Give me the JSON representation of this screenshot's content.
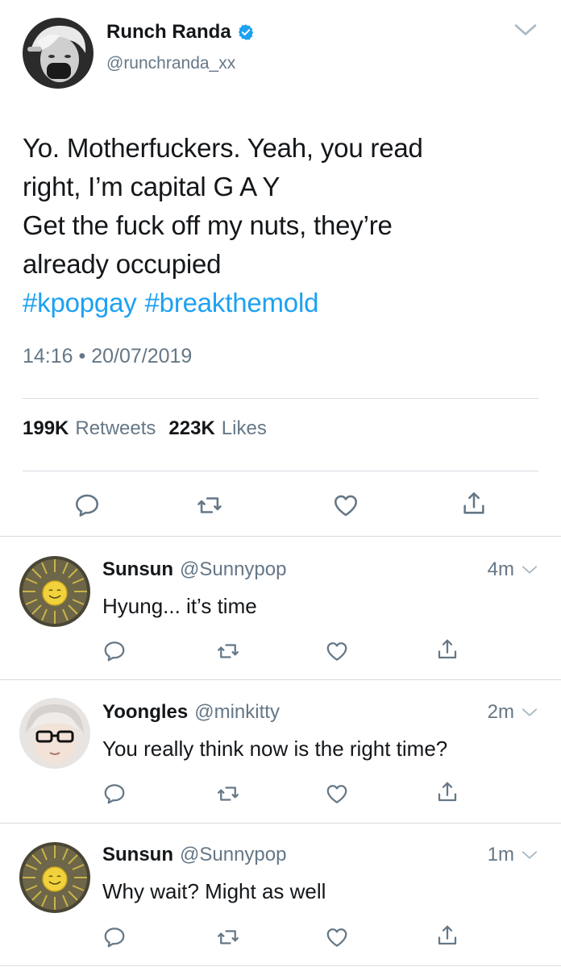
{
  "main_tweet": {
    "author_name": "Runch Randa",
    "author_handle": "@runchranda_xx",
    "text_lines": [
      "Yo. Motherfuckers. Yeah, you read",
      "right, I’m capital G A Y",
      "Get the fuck off my nuts, they’re",
      "already occupied"
    ],
    "hashtags": [
      "#kpopgay",
      "#breakthemold"
    ],
    "timestamp": "14:16 • 20/07/2019",
    "retweets_count": "199K",
    "retweets_label": "Retweets",
    "likes_count": "223K",
    "likes_label": "Likes"
  },
  "replies": [
    {
      "name": "Sunsun",
      "handle": "@Sunnypop",
      "time": "4m",
      "text": "Hyung... it’s time"
    },
    {
      "name": "Yoongles",
      "handle": "@minkitty",
      "time": "2m",
      "text": "You really think now is the right time?"
    },
    {
      "name": "Sunsun",
      "handle": "@Sunnypop",
      "time": "1m",
      "text": "Why wait? Might as well"
    }
  ],
  "icons": {
    "verified": "verified-badge-icon",
    "more": "chevron-down-icon",
    "reply": "reply-icon",
    "retweet": "retweet-icon",
    "like": "heart-icon",
    "share": "share-icon"
  },
  "colors": {
    "link": "#1da1f2",
    "secondary_text": "#657786",
    "divider": "#d7dde2",
    "icon": "#657786"
  }
}
